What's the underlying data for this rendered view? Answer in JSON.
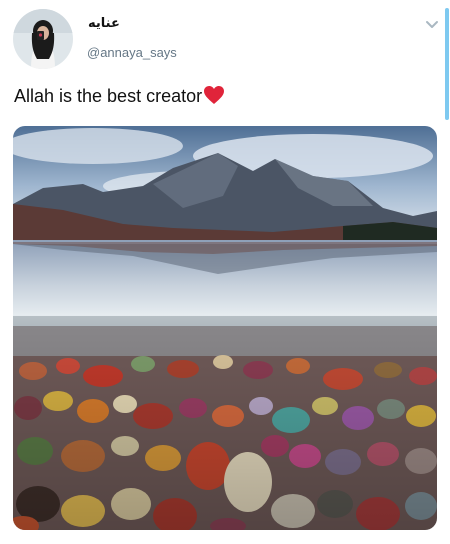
{
  "tweet": {
    "display_name": "عنايه",
    "handle": "@annaya_says",
    "text": "Allah is the best creator",
    "emoji": "red-heart-icon",
    "media": {
      "alt": ""
    }
  },
  "colors": {
    "accent": "#7ec9f0",
    "heart": "#e0243a",
    "handle": "#657786"
  }
}
